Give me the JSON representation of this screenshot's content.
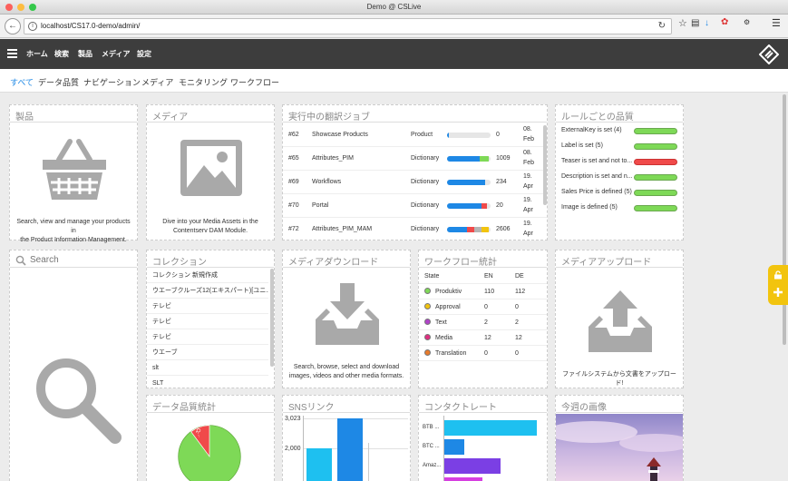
{
  "window": {
    "title": "Demo @ CSLive"
  },
  "browser": {
    "url": "localhost/CS17.0-demo/admin/"
  },
  "menu": {
    "items": [
      "ホーム",
      "検索",
      "製品",
      "メディア",
      "設定"
    ]
  },
  "subnav": {
    "items": [
      "すべて",
      "データ品質",
      "ナビゲーション",
      "メディア",
      "モニタリング",
      "ワークフロー"
    ],
    "active": 0
  },
  "products": {
    "title": "製品",
    "caption1": "Search, view and manage your products in",
    "caption2": "the Product Information Management."
  },
  "media": {
    "title": "メディア",
    "caption1": "Dive into your Media Assets in the",
    "caption2": "Contentserv DAM Module."
  },
  "jobs": {
    "title": "実行中の翻訳ジョブ",
    "rows": [
      {
        "id": "#62",
        "name": "Showcase Products",
        "type": "Product",
        "count": "0",
        "date1": "08.",
        "date2": "Feb"
      },
      {
        "id": "#65",
        "name": "Attributes_PIM",
        "type": "Dictionary",
        "count": "1009",
        "date1": "08.",
        "date2": "Feb"
      },
      {
        "id": "#69",
        "name": "Workflows",
        "type": "Dictionary",
        "count": "234",
        "date1": "19.",
        "date2": "Apr"
      },
      {
        "id": "#70",
        "name": "Portal",
        "type": "Dictionary",
        "count": "20",
        "date1": "19.",
        "date2": "Apr"
      },
      {
        "id": "#72",
        "name": "Attributes_PIM_MAM",
        "type": "Dictionary",
        "count": "2606",
        "date1": "19.",
        "date2": "Apr"
      }
    ]
  },
  "rules": {
    "title": "ルールごとの品質",
    "rows": [
      {
        "label": "ExternalKey is set (4)",
        "status": "green"
      },
      {
        "label": "Label is set (5)",
        "status": "green"
      },
      {
        "label": "Teaser is set and not to...",
        "status": "red"
      },
      {
        "label": "Description is set and n...",
        "status": "green"
      },
      {
        "label": "Sales Price is defined (5)",
        "status": "green"
      },
      {
        "label": "Image is defined (5)",
        "status": "green"
      }
    ]
  },
  "search": {
    "placeholder": "Search"
  },
  "collection": {
    "title": "コレクション",
    "items": [
      "コレクション 新規作成",
      "ウエーブクルーズ12(エキスパート)[ユニ...",
      "テレビ",
      "テレビ",
      "テレビ",
      "ウエーブ",
      "slt",
      "SLT"
    ]
  },
  "media_download": {
    "title": "メディアダウンロード",
    "caption1": "Search, browse, select and download",
    "caption2": "images, videos and other media formats."
  },
  "workflow": {
    "title": "ワークフロー統計",
    "headers": [
      "State",
      "EN",
      "DE"
    ],
    "rows": [
      {
        "state": "Produktiv",
        "en": "110",
        "de": "112",
        "color": "#7ed957"
      },
      {
        "state": "Approval",
        "en": "0",
        "de": "0",
        "color": "#f2c40e"
      },
      {
        "state": "Text",
        "en": "2",
        "de": "2",
        "color": "#b042c8"
      },
      {
        "state": "Media",
        "en": "12",
        "de": "12",
        "color": "#e02f80"
      },
      {
        "state": "Translation",
        "en": "0",
        "de": "0",
        "color": "#e87a2a"
      }
    ]
  },
  "media_upload": {
    "title": "メディアアップロード",
    "caption": "ファイルシステムから文書をアップロード!"
  },
  "dq_stats": {
    "title": "データ品質統計",
    "slice_label": "Q..."
  },
  "sns": {
    "title": "SNSリンク",
    "ticks": [
      "3,023",
      "2,000"
    ]
  },
  "contact": {
    "title": "コンタクトレート",
    "labels": [
      "BTB ...",
      "BTC ...",
      "Amaz...",
      "..."
    ]
  },
  "weekly_image": {
    "title": "今週の画像"
  },
  "colors": {
    "accent": "#1e88e5",
    "appbar": "#3d3d3d",
    "green": "#7ed957",
    "red": "#f04a4a",
    "handle": "#f2c40e"
  }
}
